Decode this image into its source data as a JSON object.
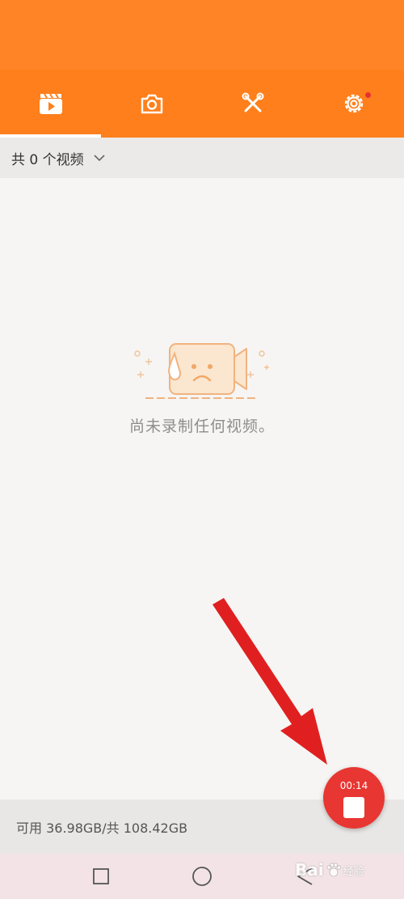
{
  "tabs": [
    {
      "icon": "video-clapper-icon",
      "active": true
    },
    {
      "icon": "camera-icon",
      "active": false
    },
    {
      "icon": "tools-icon",
      "active": false
    },
    {
      "icon": "gear-icon",
      "active": false,
      "badge": true
    }
  ],
  "filter": {
    "label": "共 0 个视频",
    "icon": "chevron-down-icon"
  },
  "empty_state": {
    "icon": "sad-camera-icon",
    "text": "尚未录制任何视频。"
  },
  "storage": {
    "text": "可用 36.98GB/共 108.42GB"
  },
  "record_button": {
    "timer": "00:14",
    "icon": "stop-icon"
  },
  "watermark": {
    "brand": "Bai",
    "text": "经验"
  },
  "colors": {
    "accent": "#ff7f1c",
    "record": "#e83632",
    "annotation": "#e02020"
  }
}
